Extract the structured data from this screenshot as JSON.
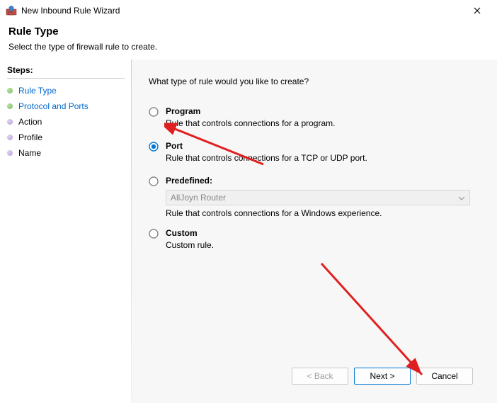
{
  "window": {
    "title": "New Inbound Rule Wizard"
  },
  "header": {
    "title": "Rule Type",
    "subtitle": "Select the type of firewall rule to create."
  },
  "sidebar": {
    "steps_label": "Steps:",
    "items": [
      {
        "label": "Rule Type"
      },
      {
        "label": "Protocol and Ports"
      },
      {
        "label": "Action"
      },
      {
        "label": "Profile"
      },
      {
        "label": "Name"
      }
    ]
  },
  "main": {
    "question": "What type of rule would you like to create?",
    "options": {
      "program": {
        "label": "Program",
        "desc": "Rule that controls connections for a program."
      },
      "port": {
        "label": "Port",
        "desc": "Rule that controls connections for a TCP or UDP port."
      },
      "predefined": {
        "label": "Predefined:",
        "dropdown_value": "AllJoyn Router",
        "desc": "Rule that controls connections for a Windows experience."
      },
      "custom": {
        "label": "Custom",
        "desc": "Custom rule."
      }
    },
    "selected": "port"
  },
  "footer": {
    "back": "< Back",
    "next": "Next >",
    "cancel": "Cancel"
  }
}
